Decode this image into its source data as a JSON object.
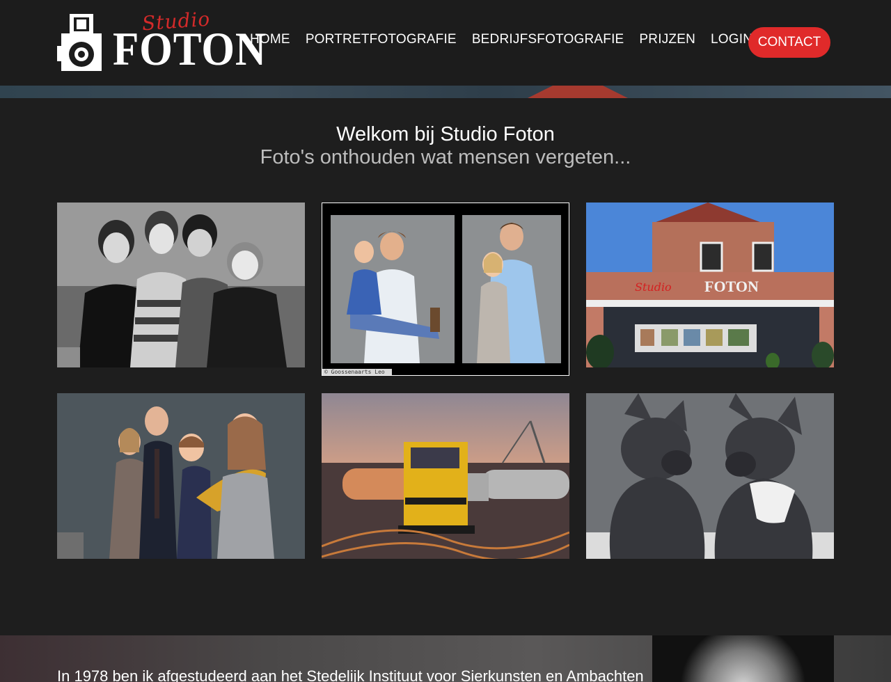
{
  "logo": {
    "script": "Studio",
    "wordmark": "FOTON"
  },
  "nav": {
    "items": [
      "HOME",
      "PORTRETFOTOGRAFIE",
      "BEDRIJFSFOTOGRAFIE",
      "PRIJZEN",
      "LOGIN"
    ],
    "contact": "CONTACT"
  },
  "welcome": {
    "title": "Welkom bij Studio Foton",
    "subtitle": "Foto's onthouden wat mensen vergeten..."
  },
  "gallery": {
    "t2_credit": "© Goossenaarts Leo",
    "t3_sign_script": "Studio",
    "t3_sign_word": "FOTON"
  },
  "about": {
    "text": "In 1978 ben ik afgestudeerd aan het Stedelijk Instituut voor Sierkunsten en Ambachten"
  },
  "colors": {
    "accent": "#e02a2a",
    "header_bg": "#1c1c1c",
    "page_bg": "#1e1e1e"
  },
  "icons": [
    "camera-logo-icon"
  ]
}
